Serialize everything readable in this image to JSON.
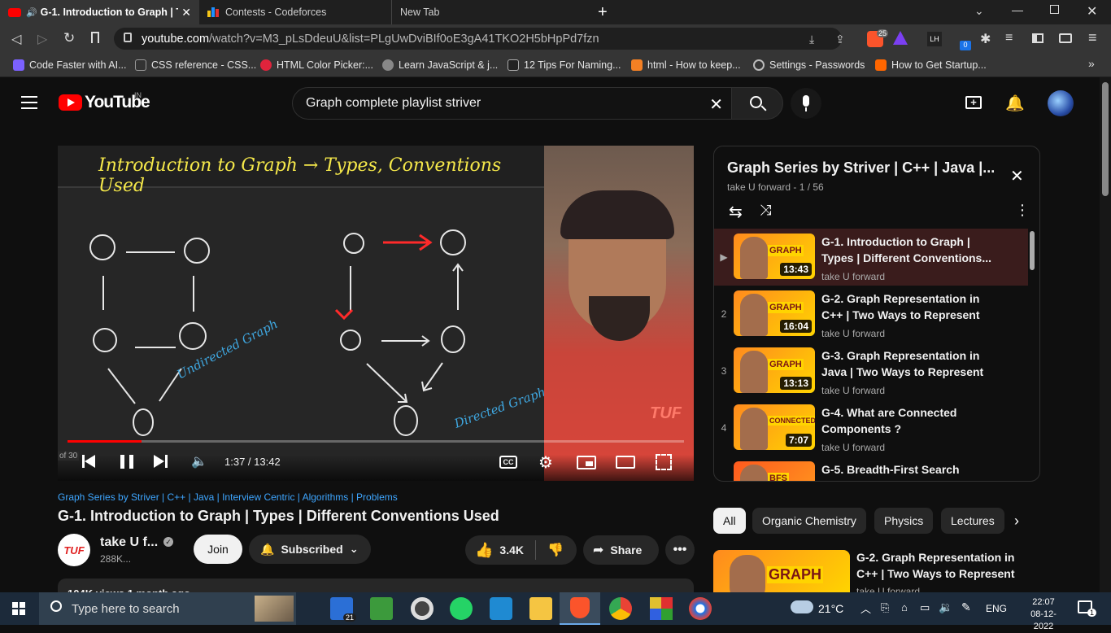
{
  "browser": {
    "tabs": [
      {
        "label": "G-1. Introduction to Graph | Ty"
      },
      {
        "label": "Contests - Codeforces"
      },
      {
        "label": "New Tab"
      }
    ],
    "url_domain": "youtube.com",
    "url_path": "/watch?v=M3_pLsDdeuU&list=PLgUwDviBIf0oE3gA41TKO2H5bHpPd7fzn",
    "brave_badge": "25",
    "ext_count": "0",
    "bookmarks": [
      {
        "label": "Code Faster with AI...",
        "color": "#7b61ff"
      },
      {
        "label": "CSS reference - CSS...",
        "color": "#333333"
      },
      {
        "label": "HTML Color Picker:...",
        "color": "#e0243c"
      },
      {
        "label": "Learn JavaScript & j...",
        "color": "#555555"
      },
      {
        "label": "12 Tips For Naming...",
        "color": "#222222"
      },
      {
        "label": "html - How to keep...",
        "color": "#f48024"
      },
      {
        "label": "Settings - Passwords",
        "color": "#777777"
      },
      {
        "label": "How to Get Startup...",
        "color": "#ff6600"
      }
    ]
  },
  "youtube": {
    "logo_text": "YouTube",
    "region": "IN",
    "search_value": "Graph complete playlist striver"
  },
  "video": {
    "board_title": "Introduction to Graph → Types, Conventions Used",
    "undirected_label": "Undirected Graph",
    "directed_label": "Directed Graph",
    "watermark": "TUF",
    "time": "1:37 / 13:42",
    "of_label": "of 30",
    "progress": 0.12,
    "cc_label": "CC"
  },
  "below": {
    "playlist_link": "Graph Series by Striver | C++ | Java | Interview Centric | Algorithms | Problems",
    "title": "G-1. Introduction to Graph | Types | Different Conventions Used",
    "channel": "take U f...",
    "channel_logo": "TUF",
    "subs": "288K...",
    "join": "Join",
    "subscribed": "Subscribed",
    "likes": "3.4K",
    "share": "Share",
    "desc_peek": "104K views  1 month ago"
  },
  "playlist": {
    "title": "Graph Series by Striver | C++ | Java |...",
    "subtitle": "take U forward - 1 / 56",
    "items": [
      {
        "idx": "▶",
        "thumb_word": "GRAPH",
        "duration": "13:43",
        "title": "G-1. Introduction to Graph | Types | Different Conventions...",
        "channel": "take U forward"
      },
      {
        "idx": "2",
        "thumb_word": "GRAPH",
        "duration": "16:04",
        "title": "G-2. Graph Representation in C++ | Two Ways to Represent",
        "channel": "take U forward"
      },
      {
        "idx": "3",
        "thumb_word": "GRAPH",
        "duration": "13:13",
        "title": "G-3. Graph Representation in Java | Two Ways to Represent",
        "channel": "take U forward"
      },
      {
        "idx": "4",
        "thumb_word": "CONNECTED",
        "duration": "7:07",
        "title": "G-4. What are Connected Components ?",
        "channel": "take U forward"
      },
      {
        "idx": "5",
        "thumb_word": "BFS",
        "duration": "",
        "title": "G-5. Breadth-First Search",
        "channel": ""
      }
    ]
  },
  "chips": [
    "All",
    "Organic Chemistry",
    "Physics",
    "Lectures"
  ],
  "recommendation": {
    "thumb_word": "GRAPH",
    "title": "G-2. Graph Representation in C++ | Two Ways to Represent",
    "channel": "take U forward"
  },
  "taskbar": {
    "search_placeholder": "Type here to search",
    "weather": "21°C",
    "lang": "ENG",
    "time": "22:07",
    "date": "08-12-2022",
    "badge": "21",
    "notif": "1"
  }
}
